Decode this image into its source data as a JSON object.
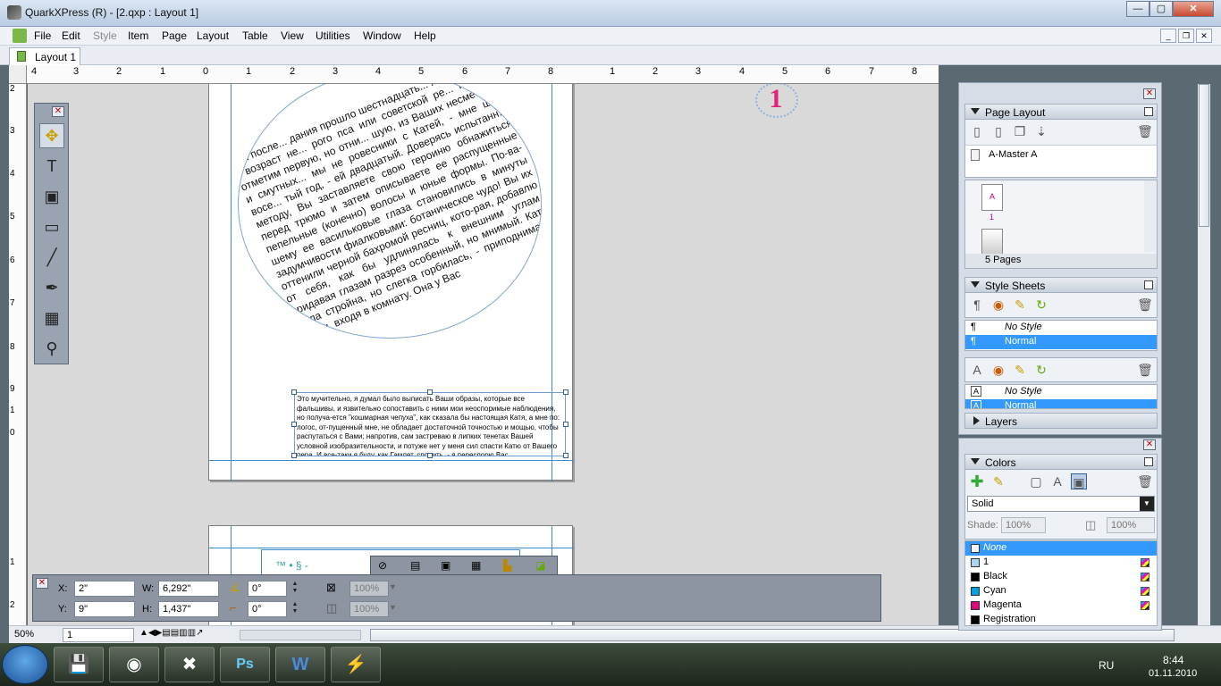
{
  "window": {
    "title": "QuarkXPress (R) - [2.qxp : Layout 1]"
  },
  "menu": [
    "File",
    "Edit",
    "Style",
    "Item",
    "Page",
    "Layout",
    "Table",
    "View",
    "Utilities",
    "Window",
    "Help"
  ],
  "tab": {
    "label": "Layout 1"
  },
  "ruler": {
    "h": [
      "4",
      "3",
      "2",
      "1",
      "0",
      "1",
      "2",
      "3",
      "4",
      "5",
      "6",
      "7",
      "8",
      "1",
      "2",
      "3",
      "4",
      "5",
      "6",
      "7",
      "8"
    ],
    "v": [
      "2",
      "3",
      "4",
      "5",
      "6",
      "7",
      "8",
      "9",
      "1",
      "0",
      "1",
      "2"
    ]
  },
  "document": {
    "page_badge": "1",
    "circle_text": "дня после... дания прошло шестнадцать... лишком лет, - возраст не... рого пса или советской ре... Кстати, отметим первую, но отни... шую, из Ваших несметных и смутных... мы не ровесники с Катей, - мне шел восе... тый год, - ей двадцатый. Доверясь испытанн... методу, Вы заставляете свою героиню обнажиться перед трюмо и затем описываете ее распущенные пепельные (конечно) волосы и юные формы. По-ва-шему ее васильковые глаза становились в минуты задумчивости фиалковыми: ботаническое чудо! Вы их оттенили черной бахромой ресниц, кото-рая, добавлю от себя, как бы удлинялась к внешним углам, придавая глазам разрез особенный, но мнимый. Катя была стройна, но слегка горбилась, - приподнимала плечи, входя в комнату. Она у Вас",
    "box_text": "Это мучительно, я думал было выписать Ваши образы, которые все фальшивы, и язвительно сопоставить с ними мои неоспоримые наблюдения, но получа-ется \"кошмарная чепуха\", как сказала бы настоящая Катя, а мне по: логос, от-пущенный мне, не обладает достаточной точностью и мощью, чтобы распутаться с Вами; напротив, сам застреваю в липких тенетах Вашей условной изобразительности, и потуже нет у меня сил спасти Катю от Вашего пера. И все-таки я буду, как Гамлет, спорить, - я переспорю Вас.",
    "next_page_text": "™  •  §  -"
  },
  "measurements": {
    "x_label": "X:",
    "x": "2\"",
    "y_label": "Y:",
    "y": "9\"",
    "w_label": "W:",
    "w": "6,292\"",
    "h_label": "H:",
    "h": "1,437\"",
    "angle": "0°",
    "corner": "0°",
    "opacity1": "100%",
    "opacity2": "100%"
  },
  "status": {
    "zoom": "50%",
    "page": "1"
  },
  "page_layout": {
    "title": "Page Layout",
    "master": "A-Master A",
    "thumb_label": "A",
    "page_num": "1",
    "pages": "5 Pages"
  },
  "style_sheets": {
    "title": "Style Sheets",
    "para": [
      "No Style",
      "Normal"
    ],
    "char": [
      "No Style",
      "Normal"
    ]
  },
  "layers": {
    "title": "Layers"
  },
  "colors": {
    "title": "Colors",
    "fill_type": "Solid",
    "shade_label": "Shade:",
    "shade": "100%",
    "opacity": "100%",
    "items": [
      {
        "name": "None",
        "color": "#ffffff"
      },
      {
        "name": "1",
        "color": "#a8d8f0"
      },
      {
        "name": "Black",
        "color": "#000000"
      },
      {
        "name": "Cyan",
        "color": "#00a0e8"
      },
      {
        "name": "Magenta",
        "color": "#e0007a"
      },
      {
        "name": "Registration",
        "color": "#000000"
      }
    ]
  },
  "taskbar": {
    "lang": "RU",
    "time": "8:44",
    "date": "01.11.2010"
  }
}
